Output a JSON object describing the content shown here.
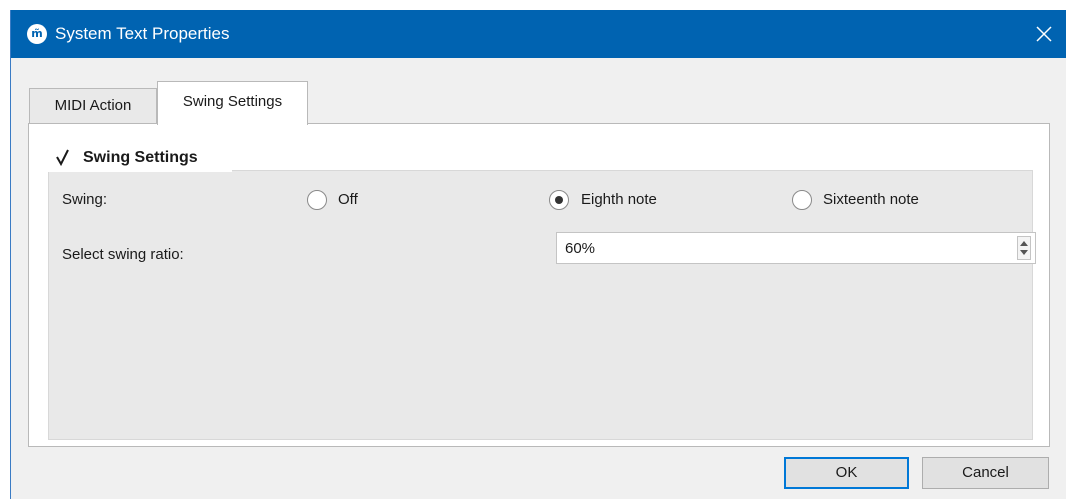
{
  "window": {
    "title": "System Text Properties",
    "app_icon_glyph": "m̃",
    "title_bar_color": "#0063b1"
  },
  "tabs": [
    {
      "label": "MIDI Action",
      "active": false
    },
    {
      "label": "Swing Settings",
      "active": true
    }
  ],
  "swing_group": {
    "title": "Swing Settings",
    "checked": true,
    "swing_label": "Swing:",
    "options": [
      {
        "label": "Off",
        "selected": false
      },
      {
        "label": "Eighth note",
        "selected": true
      },
      {
        "label": "Sixteenth note",
        "selected": false
      }
    ],
    "ratio_label": "Select swing ratio:",
    "ratio_value": "60%"
  },
  "buttons": {
    "ok": "OK",
    "cancel": "Cancel"
  }
}
